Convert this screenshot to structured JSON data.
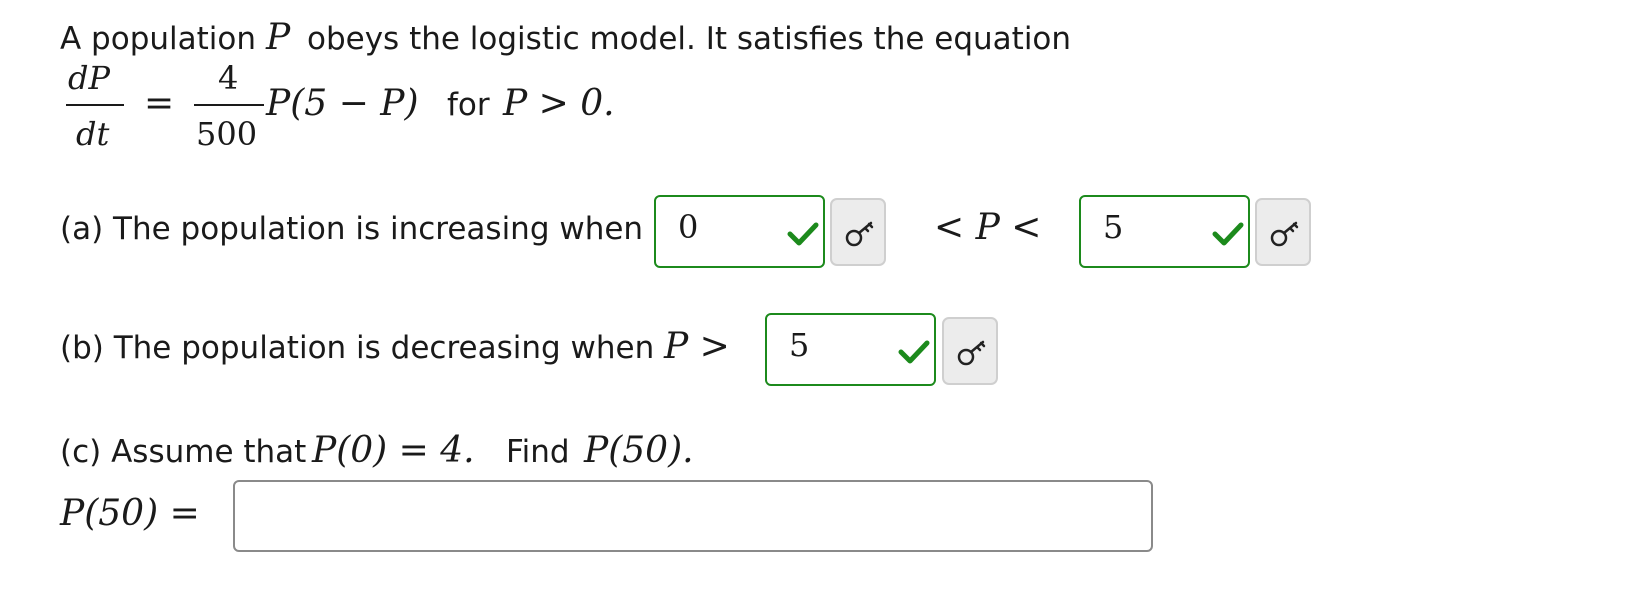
{
  "intro": {
    "text_before": "A population",
    "var": "P",
    "text_after": "obeys the logistic model. It satisfies the equation"
  },
  "equation": {
    "lhs_numerator": "dP",
    "lhs_denominator": "dt",
    "equals": "=",
    "coef_numerator": "4",
    "coef_denominator": "500",
    "expr": "P(5 − P)",
    "for_word": "for",
    "condition": "P > 0."
  },
  "part_a": {
    "label": "(a) The population is increasing when",
    "lower_answer": "0",
    "between": "< P <",
    "upper_answer": "5"
  },
  "part_b": {
    "label": "(b) The population is decreasing when",
    "relation": "P >",
    "answer": "5"
  },
  "part_c": {
    "label_before": "(c) Assume that",
    "initial": "P(0) = 4.",
    "find_word": "Find",
    "target": "P(50).",
    "input_label": "P(50) =",
    "input_value": ""
  },
  "colors": {
    "correct_border": "#1c8a1c",
    "key_button_bg": "#ececec"
  },
  "icons": {
    "correct": "check-icon",
    "answer_key": "key-icon"
  }
}
